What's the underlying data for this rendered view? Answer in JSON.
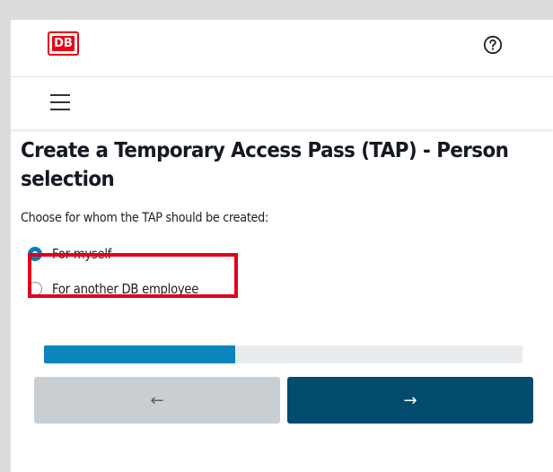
{
  "header": {
    "logo_text": "DB",
    "help_icon": "question-circle-icon"
  },
  "navbar": {
    "menu_icon": "hamburger-menu-icon"
  },
  "page": {
    "title": "Create a Temporary Access Pass (TAP) - Person selection",
    "instruction": "Choose for whom the TAP should be created:",
    "options": [
      {
        "label": "For myself",
        "selected": true
      },
      {
        "label": "For another DB employee",
        "selected": false
      }
    ]
  },
  "progress": {
    "percent": 40
  },
  "buttons": {
    "back_symbol": "←",
    "next_symbol": "→"
  },
  "colors": {
    "brand_red": "#ec0016",
    "accent_blue": "#0a84bb",
    "next_button": "#004b6e",
    "back_button": "#c9ced3",
    "highlight": "#e0001b"
  }
}
